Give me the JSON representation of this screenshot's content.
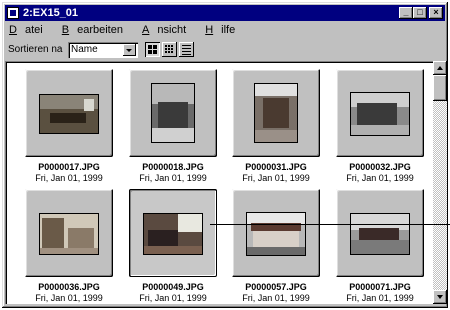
{
  "window": {
    "title": "2:EX15_01"
  },
  "titlebar_buttons": {
    "minimize": "_",
    "maximize": "□",
    "close": "×"
  },
  "menu": [
    {
      "label": "Datei",
      "u": "D",
      "rest": "atei"
    },
    {
      "label": "Bearbeiten",
      "u": "B",
      "rest": "earbeiten"
    },
    {
      "label": "Ansicht",
      "u": "A",
      "rest": "nsicht"
    },
    {
      "label": "Hilfe",
      "u": "H",
      "rest": "ilfe"
    }
  ],
  "toolbar": {
    "sort_label": "Sortieren na",
    "sort_value": "Name",
    "view_buttons": [
      "large-thumbnails",
      "small-thumbnails",
      "details"
    ],
    "active_view": "large-thumbnails"
  },
  "items": [
    {
      "name": "P0000017.JPG",
      "date": "Fri, Jan 01, 1999",
      "orientation": "landscape",
      "selected": false
    },
    {
      "name": "P0000018.JPG",
      "date": "Fri, Jan 01, 1999",
      "orientation": "portrait",
      "selected": false
    },
    {
      "name": "P0000031.JPG",
      "date": "Fri, Jan 01, 1999",
      "orientation": "portrait",
      "selected": false
    },
    {
      "name": "P0000032.JPG",
      "date": "Fri, Jan 01, 1999",
      "orientation": "landscape",
      "selected": false
    },
    {
      "name": "P0000036.JPG",
      "date": "Fri, Jan 01, 1999",
      "orientation": "landscape",
      "selected": false
    },
    {
      "name": "P0000049.JPG",
      "date": "Fri, Jan 01, 1999",
      "orientation": "landscape",
      "selected": true
    },
    {
      "name": "P0000057.JPG",
      "date": "Fri, Jan 01, 1999",
      "orientation": "landscape",
      "selected": false
    },
    {
      "name": "P0000071.JPG",
      "date": "Fri, Jan 01, 1999",
      "orientation": "landscape",
      "selected": false
    }
  ]
}
